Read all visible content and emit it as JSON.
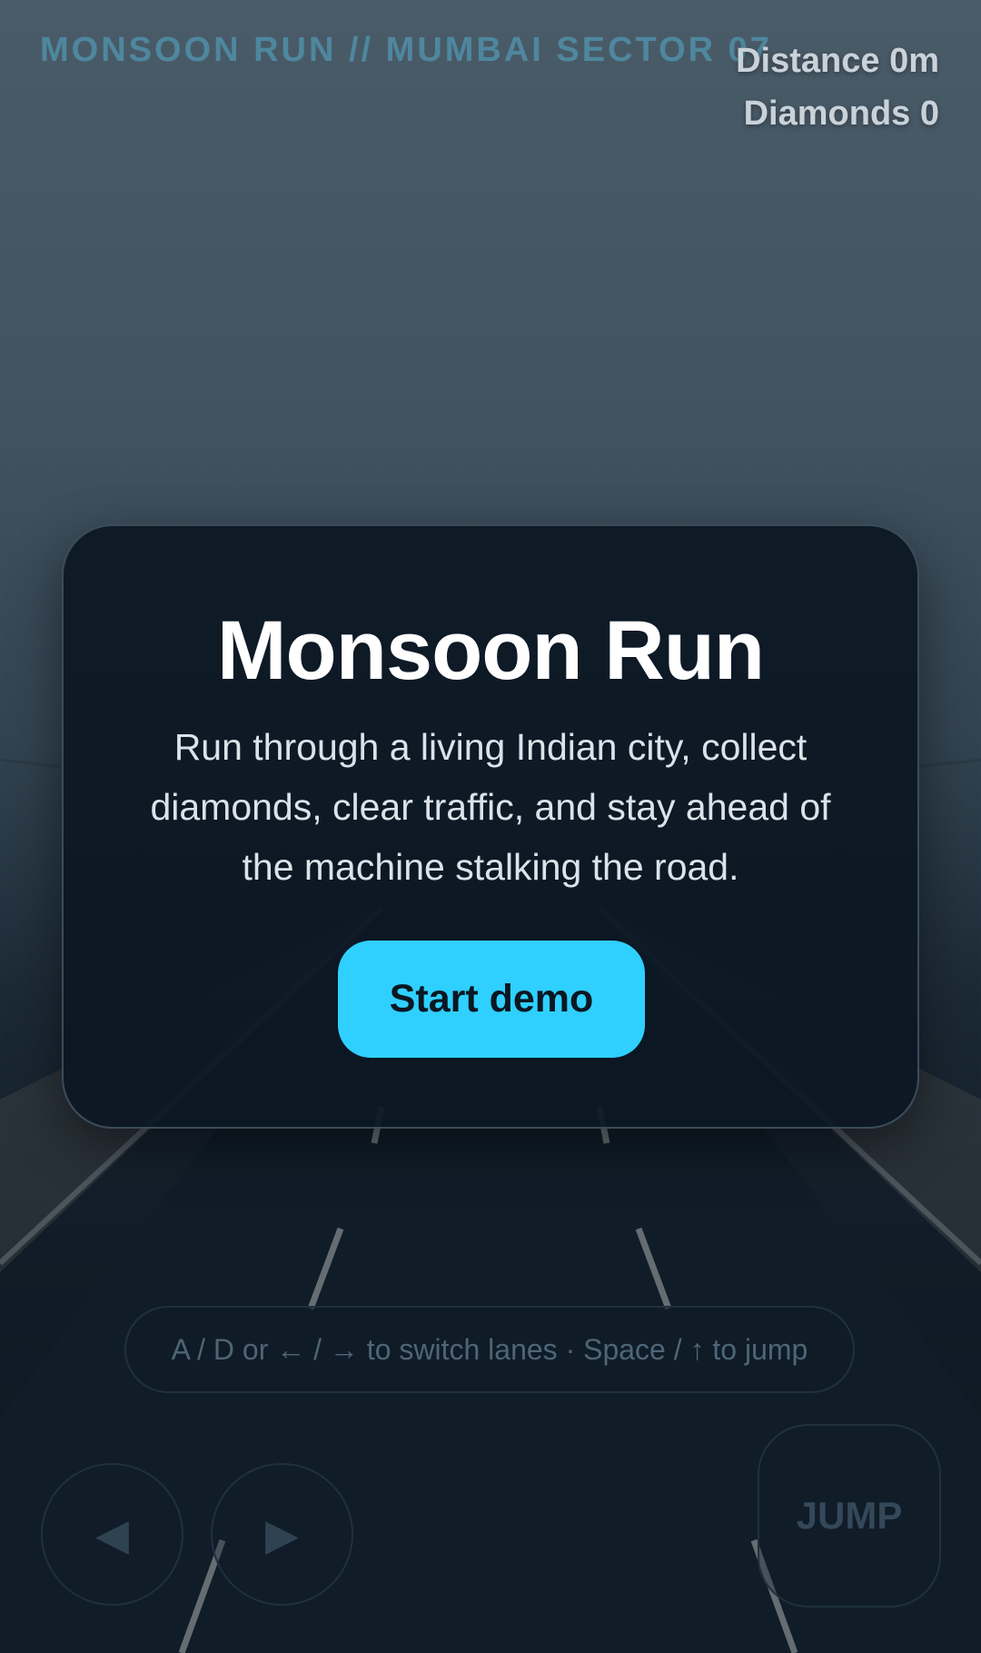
{
  "hud": {
    "title": "MONSOON RUN // MUMBAI SECTOR 07",
    "distance": "Distance 0m",
    "diamonds": "Diamonds 0"
  },
  "overlay": {
    "title": "Monsoon Run",
    "description": "Run through a living Indian city, collect diamonds, clear traffic, and stay ahead of the machine stalking the road.",
    "start_label": "Start demo"
  },
  "controls": {
    "hint": "A / D or ← / → to switch lanes · Space / ↑ to jump",
    "left_icon": "◀",
    "right_icon": "▶",
    "jump_label": "JUMP"
  },
  "colors": {
    "accent": "#2fd0ff",
    "hud_title": "#4f8fa8",
    "card_bg": "#0b1722"
  }
}
